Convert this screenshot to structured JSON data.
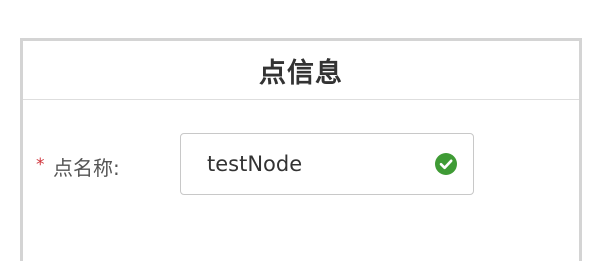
{
  "panel": {
    "title": "点信息"
  },
  "form": {
    "required_mark": "*",
    "name_label": "点名称:",
    "name_value": "testNode",
    "name_status": "valid"
  },
  "icons": {
    "status_icon": "check-circle-icon"
  },
  "colors": {
    "required": "#d0333b",
    "success": "#3f9b35",
    "border": "#d4d4d4"
  }
}
